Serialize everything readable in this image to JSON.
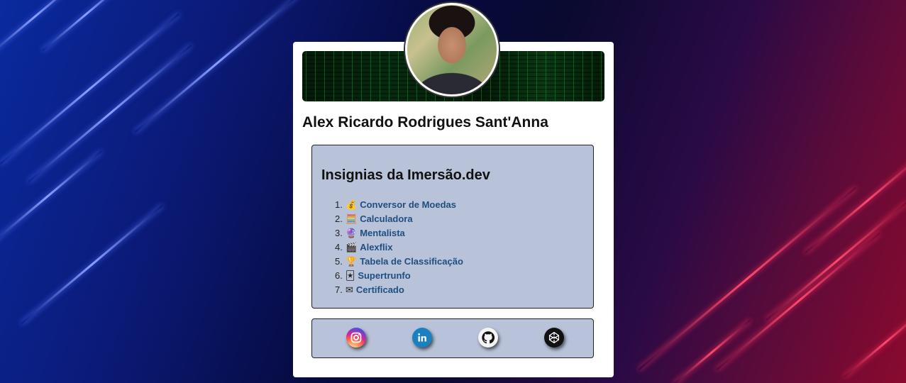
{
  "profile": {
    "name": "Alex Ricardo Rodrigues Sant'Anna"
  },
  "badges": {
    "title": "Insignias da Imersão.dev",
    "items": [
      {
        "num": "1.",
        "emoji": "💰",
        "label": "Conversor de Moedas"
      },
      {
        "num": "2.",
        "emoji": "🧮",
        "label": "Calculadora"
      },
      {
        "num": "3.",
        "emoji": "🔮",
        "label": "Mentalista"
      },
      {
        "num": "4.",
        "emoji": "🎬",
        "label": "Alexflix"
      },
      {
        "num": "5.",
        "emoji": "🏆",
        "label": "Tabela de Classificação"
      },
      {
        "num": "6.",
        "emoji": "🃏",
        "label": "Supertrunfo"
      },
      {
        "num": "7.",
        "emoji": "✉",
        "label": "Certificado"
      }
    ]
  },
  "social": [
    {
      "name": "instagram-icon"
    },
    {
      "name": "linkedin-icon"
    },
    {
      "name": "github-icon"
    },
    {
      "name": "codepen-icon"
    }
  ],
  "colors": {
    "card_bg": "#ffffff",
    "panel_bg": "#b8c2d8",
    "link": "#1f4f80"
  }
}
